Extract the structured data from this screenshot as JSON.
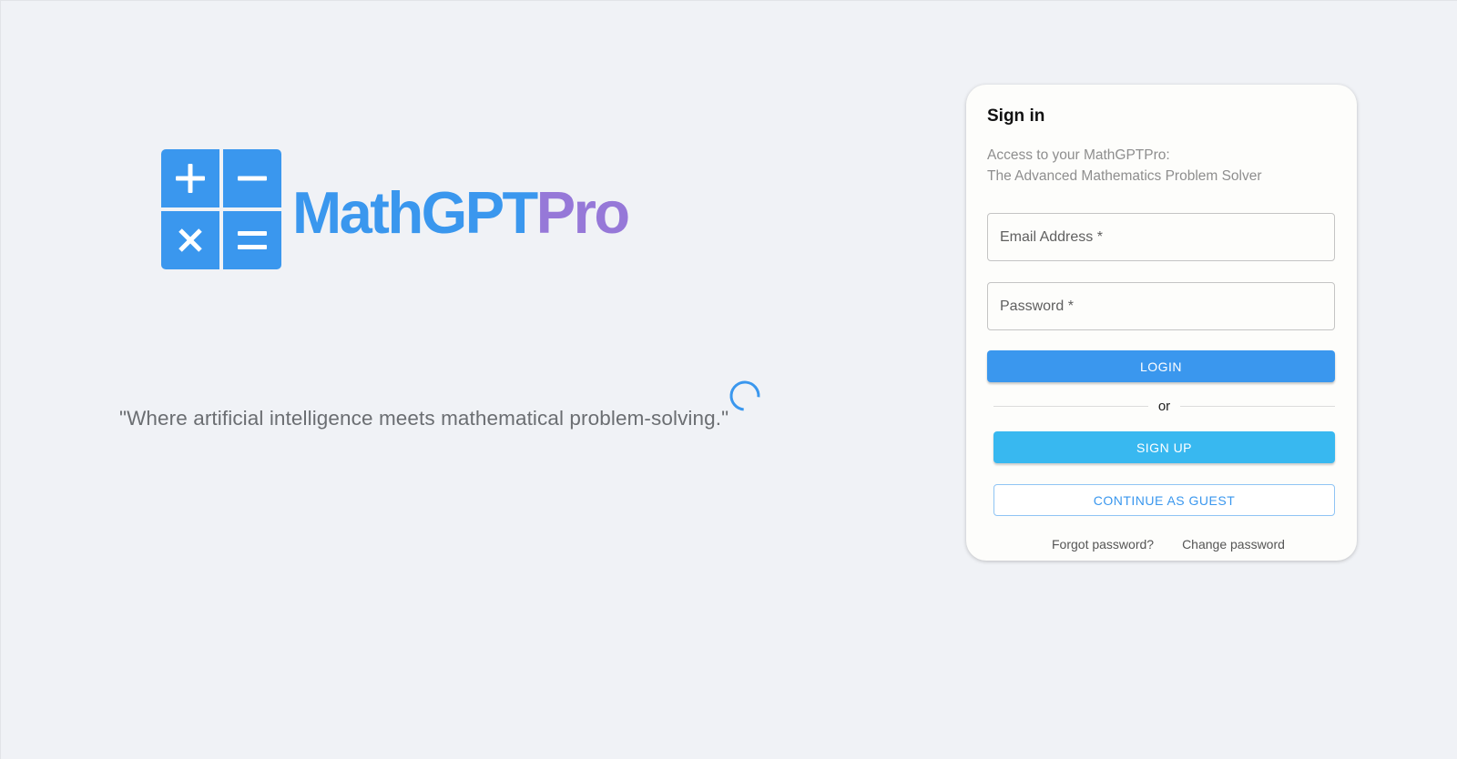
{
  "logo": {
    "text_primary": "MathGPT",
    "text_accent": "Pro",
    "icons": [
      "plus-icon",
      "minus-icon",
      "times-icon",
      "equals-icon"
    ],
    "colors": {
      "primary": "#3a97ee",
      "accent": "#9678d8"
    }
  },
  "tagline": "\"Where artificial intelligence meets mathematical problem-solving.\"",
  "signin": {
    "title": "Sign in",
    "subtitle_line1": "Access to your MathGPTPro:",
    "subtitle_line2": "The Advanced Mathematics Problem Solver",
    "email_placeholder": "Email Address *",
    "email_value": "",
    "password_placeholder": "Password *",
    "password_value": "",
    "login_label": "LOGIN",
    "divider_text": "or",
    "signup_label": "SIGN UP",
    "guest_label": "CONTINUE AS GUEST",
    "forgot_label": "Forgot password?",
    "change_label": "Change password"
  },
  "colors": {
    "background": "#f0f2f6",
    "login_button": "#3a97ee",
    "signup_button": "#38b8f0",
    "guest_border": "#8fc4f4"
  }
}
